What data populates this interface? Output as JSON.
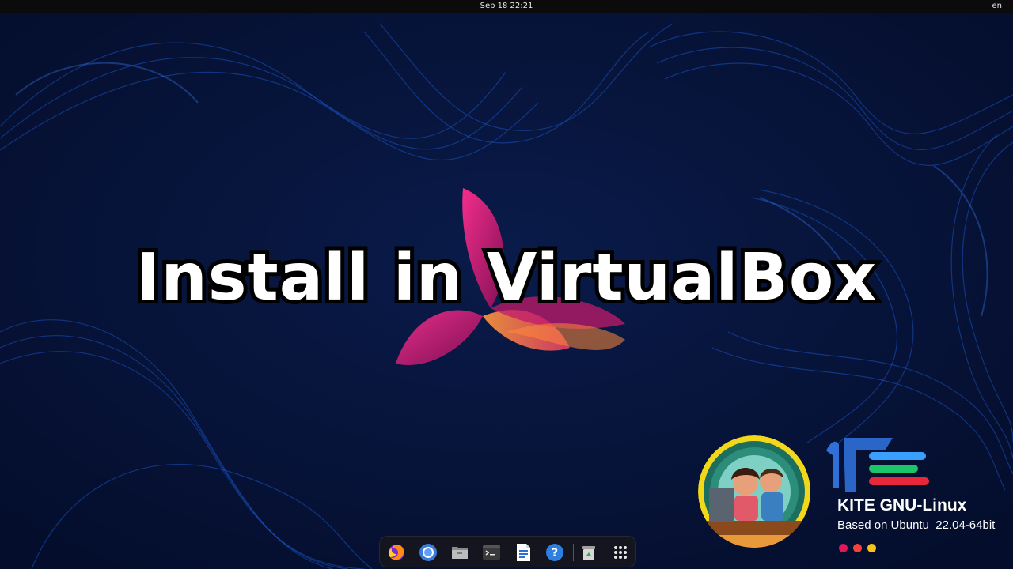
{
  "topbar": {
    "datetime": "Sep 18  22:21",
    "language": "en"
  },
  "headline": "Install in VirtualBox",
  "branding": {
    "title": "KITE GNU-Linux",
    "subtitle": "Based on Ubuntu  22.04-64bit",
    "dot_colors": [
      "#e0185a",
      "#f2433a",
      "#f6c416"
    ]
  },
  "dock": {
    "items": [
      "firefox-icon",
      "chromium-icon",
      "files-icon",
      "terminal-icon",
      "text-editor-icon",
      "help-icon",
      "trash-icon",
      "app-grid-icon"
    ]
  },
  "colors": {
    "background": "#061238",
    "wave": "#1b5bd6",
    "flower_pink": "#e8298a",
    "flower_orange": "#f27a2a"
  }
}
